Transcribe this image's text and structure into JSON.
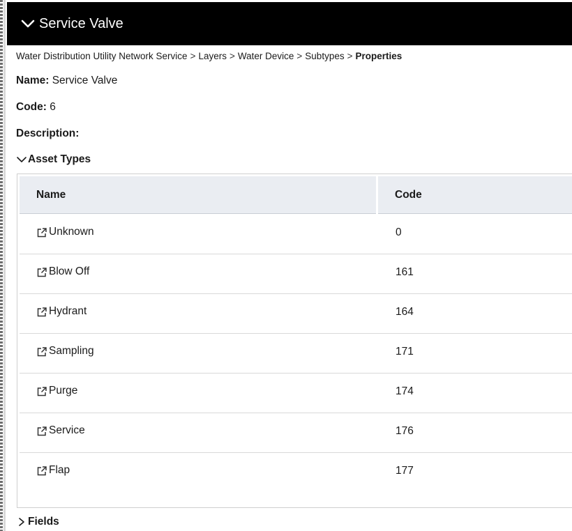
{
  "header": {
    "title": "Service Valve",
    "icon": "chevron-down-icon"
  },
  "breadcrumb": {
    "items": [
      "Water Distribution Utility Network Service",
      "Layers",
      "Water Device",
      "Subtypes"
    ],
    "separator": ">",
    "current": "Properties"
  },
  "properties": {
    "name_label": "Name:",
    "name_value": "Service Valve",
    "code_label": "Code:",
    "code_value": "6",
    "description_label": "Description:"
  },
  "asset_types": {
    "label": "Asset Types",
    "expanded": true,
    "columns": [
      "Name",
      "Code"
    ],
    "rows": [
      {
        "name": "Unknown",
        "code": "0"
      },
      {
        "name": "Blow Off",
        "code": "161"
      },
      {
        "name": "Hydrant",
        "code": "164"
      },
      {
        "name": "Sampling",
        "code": "171"
      },
      {
        "name": "Purge",
        "code": "174"
      },
      {
        "name": "Service",
        "code": "176"
      },
      {
        "name": "Flap",
        "code": "177"
      }
    ]
  },
  "fields": {
    "label": "Fields",
    "expanded": false
  },
  "colors": {
    "header_bg": "#000000",
    "table_header_bg": "#eaedf2"
  }
}
